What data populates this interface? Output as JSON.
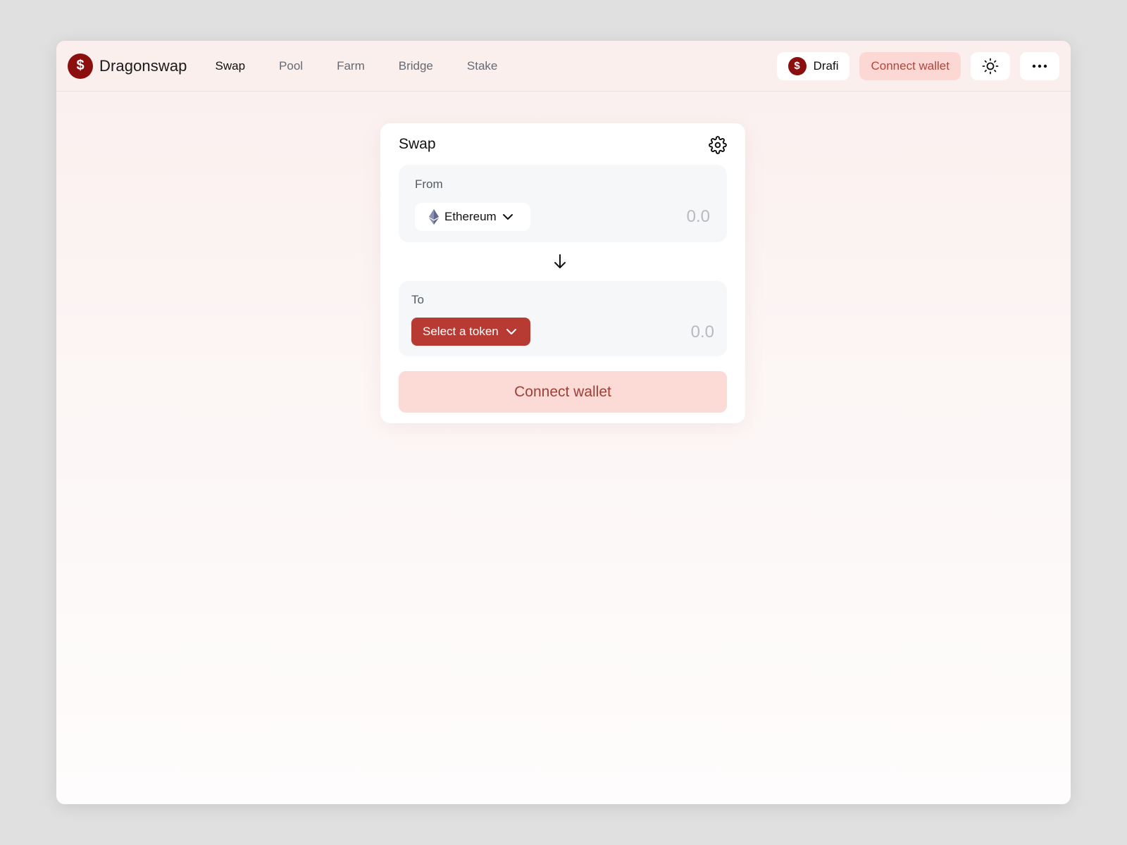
{
  "header": {
    "brand_name": "Dragonswap",
    "brand_icon": "dollar-icon",
    "nav": [
      {
        "label": "Swap",
        "active": true
      },
      {
        "label": "Pool",
        "active": false
      },
      {
        "label": "Farm",
        "active": false
      },
      {
        "label": "Bridge",
        "active": false
      },
      {
        "label": "Stake",
        "active": false
      }
    ],
    "token_button_label": "Drafi",
    "connect_wallet_label": "Connect wallet",
    "theme_icon": "sun-icon",
    "more_icon": "more-horizontal-icon"
  },
  "swap": {
    "title": "Swap",
    "settings_icon": "gear-icon",
    "from": {
      "label": "From",
      "token": "Ethereum",
      "token_icon": "ethereum-icon",
      "amount_placeholder": "0.0"
    },
    "switch_icon": "arrow-down-icon",
    "to": {
      "label": "To",
      "select_label": "Select a token",
      "amount_placeholder": "0.0"
    },
    "connect_wallet_label": "Connect wallet"
  },
  "colors": {
    "brand": "#8b0f0f",
    "accent": "#b83b33",
    "connect_bg": "#fcd8d4",
    "connect_text": "#b0463d"
  }
}
